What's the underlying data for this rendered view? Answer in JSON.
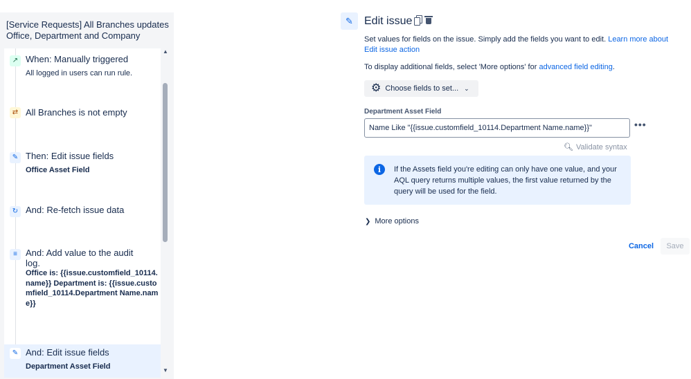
{
  "rule": {
    "title": "[Service Requests] All Branches updates Office, Department and Company",
    "steps": [
      {
        "title": "When: Manually triggered",
        "sub": "All logged in users can run rule.",
        "icon": "cursor-click-icon"
      },
      {
        "title": "All Branches is not empty",
        "icon": "shuffle-condition-icon"
      },
      {
        "title": "Then: Edit issue fields",
        "bold": "Office Asset Field",
        "icon": "pencil-icon"
      },
      {
        "title": "And: Re-fetch issue data",
        "icon": "refresh-icon"
      },
      {
        "title": "And: Add value to the audit log.",
        "bold": "Office is: {{issue.customfield_10114.name}} Department is: {{issue.customfield_10114.Department Name.name}}",
        "icon": "audit-log-icon"
      },
      {
        "title": "And: Edit issue fields",
        "bold": "Department Asset Field",
        "icon": "pencil-icon",
        "selected": true
      }
    ]
  },
  "edit": {
    "title": "Edit issue",
    "desc_prefix": "Set values for fields on the issue. Simply add the fields you want to edit. ",
    "desc_link": "Learn more about Edit issue action",
    "desc2_prefix": "To display additional fields, select 'More options' for ",
    "desc2_link": "advanced field editing",
    "desc2_suffix": ".",
    "choose_fields": "Choose fields to set...",
    "field_label": "Department Asset Field",
    "field_value": "Name Like \"{{issue.customfield_10114.Department Name.name}}\"",
    "validate": "Validate syntax",
    "info": "If the Assets field you're editing can only have one value, and your AQL query returns multiple values, the first value returned by the query will be used for the field.",
    "more_options": "More options",
    "cancel": "Cancel",
    "save": "Save",
    "more_glyph": "•••"
  },
  "colors": {
    "accent": "#0c66e4",
    "panel_bg": "#f4f5f7",
    "selected_bg": "#e9f2ff",
    "info_bg": "#e9f2ff"
  }
}
